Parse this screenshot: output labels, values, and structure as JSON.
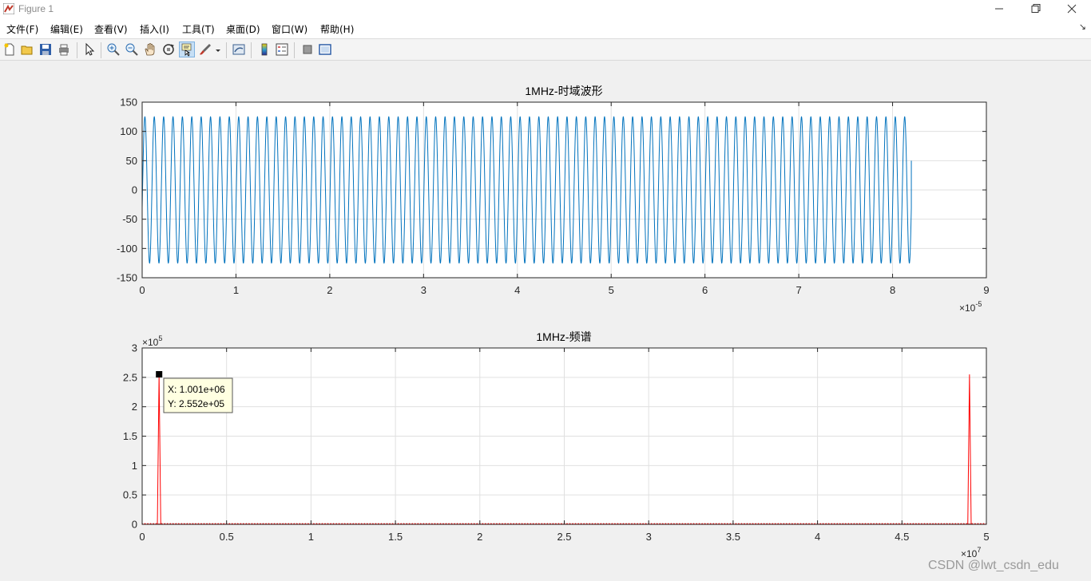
{
  "window": {
    "title": "Figure 1"
  },
  "menu": {
    "items": [
      "文件(F)",
      "编辑(E)",
      "查看(V)",
      "插入(I)",
      "工具(T)",
      "桌面(D)",
      "窗口(W)",
      "帮助(H)"
    ]
  },
  "toolbar": {
    "icons": [
      "new-figure-icon",
      "open-file-icon",
      "save-icon",
      "print-icon",
      "pointer-icon",
      "zoom-in-icon",
      "zoom-out-icon",
      "pan-hand-icon",
      "rotate-3d-icon",
      "data-cursor-icon",
      "brush-icon",
      "brush-dropdown-icon",
      "link-plot-icon",
      "colorbar-icon",
      "legend-icon",
      "hide-plot-tools-icon",
      "show-plot-tools-icon"
    ]
  },
  "chart_data": [
    {
      "type": "line",
      "title": "1MHz-时域波形",
      "xlabel": "",
      "ylabel": "",
      "xlim": [
        0,
        9
      ],
      "ylim": [
        -150,
        150
      ],
      "x_multiplier": "×10^-5",
      "x_exponent": "-5",
      "xticks": [
        "0",
        "1",
        "2",
        "3",
        "4",
        "5",
        "6",
        "7",
        "8",
        "9"
      ],
      "yticks": [
        "150",
        "100",
        "50",
        "0",
        "-50",
        "-100",
        "-150"
      ],
      "grid": true,
      "series": [
        {
          "color": "#0072bd",
          "amplitude": 125,
          "cycles": 82,
          "x_end": 8.2,
          "end_value": 50
        }
      ]
    },
    {
      "type": "line",
      "title": "1MHz-频谱",
      "xlabel": "",
      "ylabel": "",
      "xlim": [
        0,
        5
      ],
      "ylim": [
        0,
        3
      ],
      "x_multiplier": "×10^7",
      "y_multiplier": "×10^5",
      "x_exponent": "7",
      "y_exponent": "5",
      "xticks": [
        "0",
        "0.5",
        "1",
        "1.5",
        "2",
        "2.5",
        "3",
        "3.5",
        "4",
        "4.5",
        "5"
      ],
      "yticks": [
        "3",
        "2.5",
        "2",
        "1.5",
        "1",
        "0.5",
        "0"
      ],
      "grid": true,
      "series": [
        {
          "color": "#ff0000",
          "peaks": [
            {
              "x": 0.1001,
              "y": 2.552
            },
            {
              "x": 4.9,
              "y": 2.55
            }
          ]
        }
      ],
      "datatip": {
        "x_label": "X: 1.001e+06",
        "y_label": "Y: 2.552e+05",
        "x": 0.1001,
        "y": 2.552
      }
    }
  ],
  "watermark": "CSDN @lwt_csdn_edu"
}
